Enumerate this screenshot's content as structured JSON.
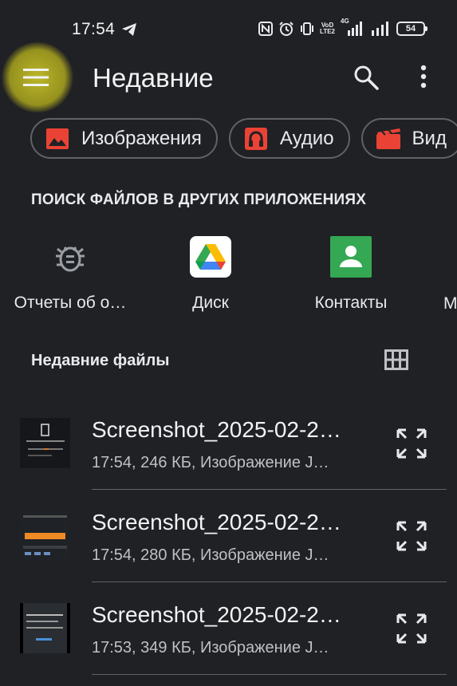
{
  "status_bar": {
    "time": "17:54",
    "battery": "54",
    "network_top": "4G",
    "network_label_1": "VoD",
    "network_label_2": "LTE2"
  },
  "app_bar": {
    "title": "Недавние",
    "icons": [
      "menu-icon",
      "search-icon",
      "more-vert-icon"
    ]
  },
  "chips": [
    {
      "label": "Изображения",
      "icon": "image-icon",
      "color": "#ea4335"
    },
    {
      "label": "Аудио",
      "icon": "headphones-icon",
      "color": "#ea4335"
    },
    {
      "label": "Вид",
      "icon": "video-icon",
      "color": "#ea4335"
    }
  ],
  "other_apps": {
    "heading": "ПОИСК ФАЙЛОВ В ДРУГИХ ПРИЛОЖЕНИЯХ",
    "items": [
      {
        "label": "Отчеты об о…",
        "icon": "bug-icon"
      },
      {
        "label": "Диск",
        "icon": "drive-icon"
      },
      {
        "label": "Контакты",
        "icon": "contacts-icon"
      },
      {
        "label": "М",
        "icon": "app-icon"
      }
    ]
  },
  "recent_files": {
    "title": "Недавние файлы",
    "items": [
      {
        "name": "Screenshot_2025-02-2…",
        "meta": "17:54, 246 КБ, Изображение J…"
      },
      {
        "name": "Screenshot_2025-02-2…",
        "meta": "17:54, 280 КБ, Изображение J…"
      },
      {
        "name": "Screenshot_2025-02-2…",
        "meta": "17:53, 349 КБ, Изображение J…"
      }
    ]
  },
  "colors": {
    "background": "#202124",
    "highlight": "#c4be28",
    "accent_red": "#ea4335",
    "contacts_green": "#34a853"
  }
}
